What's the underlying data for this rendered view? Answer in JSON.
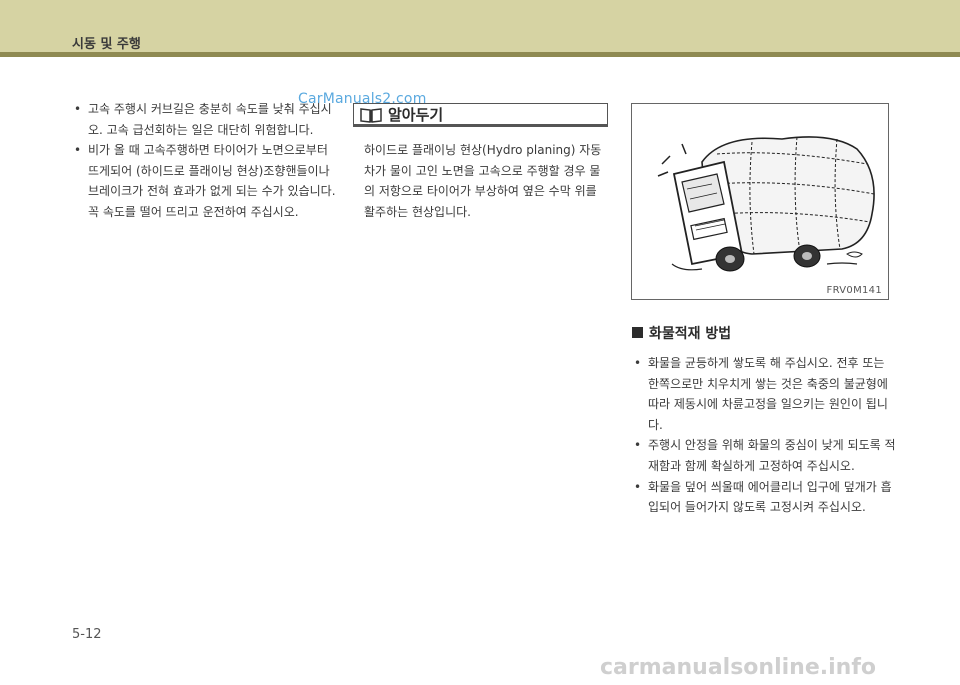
{
  "header": {
    "title": "시동 및 주행"
  },
  "watermark": {
    "top": "CarManuals2.com",
    "bottom": "carmanualsonline.info"
  },
  "left_column": {
    "bullets": [
      "고속 주행시 커브길은 충분히 속도를 낮춰 주십시오. 고속 급선회하는 일은 대단히 위험합니다.",
      "비가 올 때 고속주행하면 타이어가 노면으로부터 뜨게되어 (하이드로 플래이닝 현상)조향핸들이나 브레이크가 전혀 효과가 없게 되는 수가 있습니다. 꼭 속도를 떨어 뜨리고 운전하여 주십시오."
    ]
  },
  "note": {
    "icon": "book-icon",
    "title": "알아두기",
    "body": "하이드로 플래이닝 현상(Hydro planing) 자동차가 물이 고인 노면을 고속으로 주행할 경우 물의 저항으로 타이어가 부상하여 옆은 수막 위를 활주하는 현상입니다."
  },
  "figure": {
    "code": "FRV0M141",
    "illustration": "overloaded-truck-illustration"
  },
  "section": {
    "icon": "square-bullet-icon",
    "heading": "화물적재 방법",
    "bullets": [
      "화물을 균등하게 쌓도록 해 주십시오. 전후 또는 한쪽으로만 치우치게 쌓는 것은 축중의 불균형에 따라 제동시에 차륜고정을 일으키는 원인이 됩니다.",
      "주행시 안정을 위해 화물의 중심이 낮게 되도록 적재함과 함께 확실하게 고정하여 주십시오.",
      "화물을 덮어 씌울때 에어클리너 입구에 덮개가 흡입되어 들어가지 않도록 고정시켜 주십시오."
    ]
  },
  "footer": {
    "page_number": "5-12"
  }
}
